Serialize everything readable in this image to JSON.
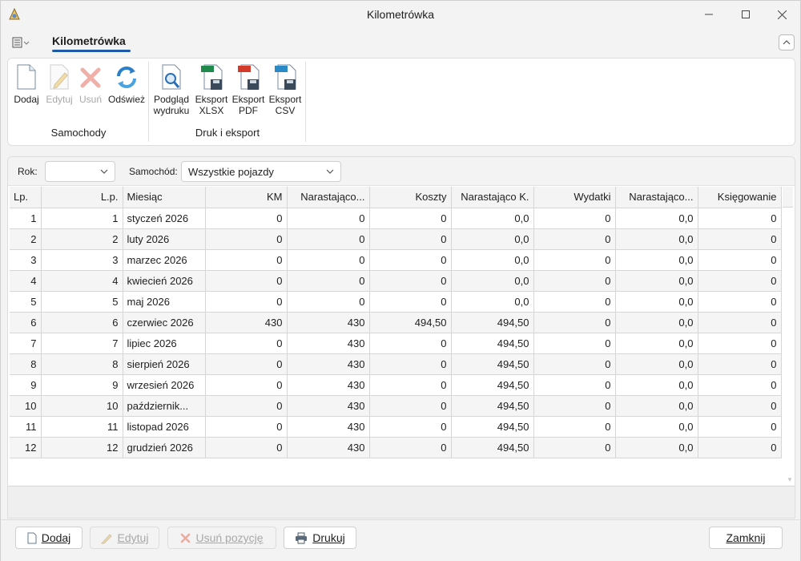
{
  "window": {
    "title": "Kilometrówka"
  },
  "ribbon": {
    "tab": "Kilometrówka",
    "groups": [
      {
        "label": "Samochody",
        "buttons": [
          {
            "label": "Dodaj",
            "icon": "new-document-icon",
            "enabled": true
          },
          {
            "label": "Edytuj",
            "icon": "edit-document-icon",
            "enabled": false
          },
          {
            "label": "Usuń",
            "icon": "delete-x-icon",
            "enabled": false
          },
          {
            "label": "Odśwież",
            "icon": "refresh-icon",
            "enabled": true
          }
        ]
      },
      {
        "label": "Druk i eksport",
        "buttons": [
          {
            "label": "Podgląd",
            "label2": "wydruku",
            "icon": "print-preview-icon",
            "enabled": true
          },
          {
            "label": "Eksport",
            "label2": "XLSX",
            "icon": "xlsx-icon",
            "enabled": true
          },
          {
            "label": "Eksport",
            "label2": "PDF",
            "icon": "pdf-icon",
            "enabled": true
          },
          {
            "label": "Eksport",
            "label2": "CSV",
            "icon": "csv-icon",
            "enabled": true
          }
        ]
      }
    ]
  },
  "filters": {
    "year_label": "Rok:",
    "year_value": "",
    "car_label": "Samochód:",
    "car_value": "Wszystkie pojazdy"
  },
  "table": {
    "columns": [
      "Lp.",
      "L.p.",
      "Miesiąc",
      "KM",
      "Narastająco...",
      "Koszty",
      "Narastająco K.",
      "Wydatki",
      "Narastająco...",
      "Księgowanie"
    ],
    "rows": [
      [
        "1",
        "1",
        "styczeń 2026",
        "0",
        "0",
        "0",
        "0,0",
        "0",
        "0,0",
        "0"
      ],
      [
        "2",
        "2",
        "luty 2026",
        "0",
        "0",
        "0",
        "0,0",
        "0",
        "0,0",
        "0"
      ],
      [
        "3",
        "3",
        "marzec 2026",
        "0",
        "0",
        "0",
        "0,0",
        "0",
        "0,0",
        "0"
      ],
      [
        "4",
        "4",
        "kwiecień 2026",
        "0",
        "0",
        "0",
        "0,0",
        "0",
        "0,0",
        "0"
      ],
      [
        "5",
        "5",
        "maj 2026",
        "0",
        "0",
        "0",
        "0,0",
        "0",
        "0,0",
        "0"
      ],
      [
        "6",
        "6",
        "czerwiec 2026",
        "430",
        "430",
        "494,50",
        "494,50",
        "0",
        "0,0",
        "0"
      ],
      [
        "7",
        "7",
        "lipiec 2026",
        "0",
        "430",
        "0",
        "494,50",
        "0",
        "0,0",
        "0"
      ],
      [
        "8",
        "8",
        "sierpień 2026",
        "0",
        "430",
        "0",
        "494,50",
        "0",
        "0,0",
        "0"
      ],
      [
        "9",
        "9",
        "wrzesień 2026",
        "0",
        "430",
        "0",
        "494,50",
        "0",
        "0,0",
        "0"
      ],
      [
        "10",
        "10",
        "październik...",
        "0",
        "430",
        "0",
        "494,50",
        "0",
        "0,0",
        "0"
      ],
      [
        "11",
        "11",
        "listopad 2026",
        "0",
        "430",
        "0",
        "494,50",
        "0",
        "0,0",
        "0"
      ],
      [
        "12",
        "12",
        "grudzień 2026",
        "0",
        "430",
        "0",
        "494,50",
        "0",
        "0,0",
        "0"
      ]
    ]
  },
  "bottom_buttons": {
    "add": "Dodaj",
    "edit": "Edytuj",
    "delete": "Usuń pozycję",
    "print": "Drukuj",
    "close": "Zamknij"
  },
  "colors": {
    "accent": "#1f5aa6",
    "disabled": "#a8a8a8"
  }
}
